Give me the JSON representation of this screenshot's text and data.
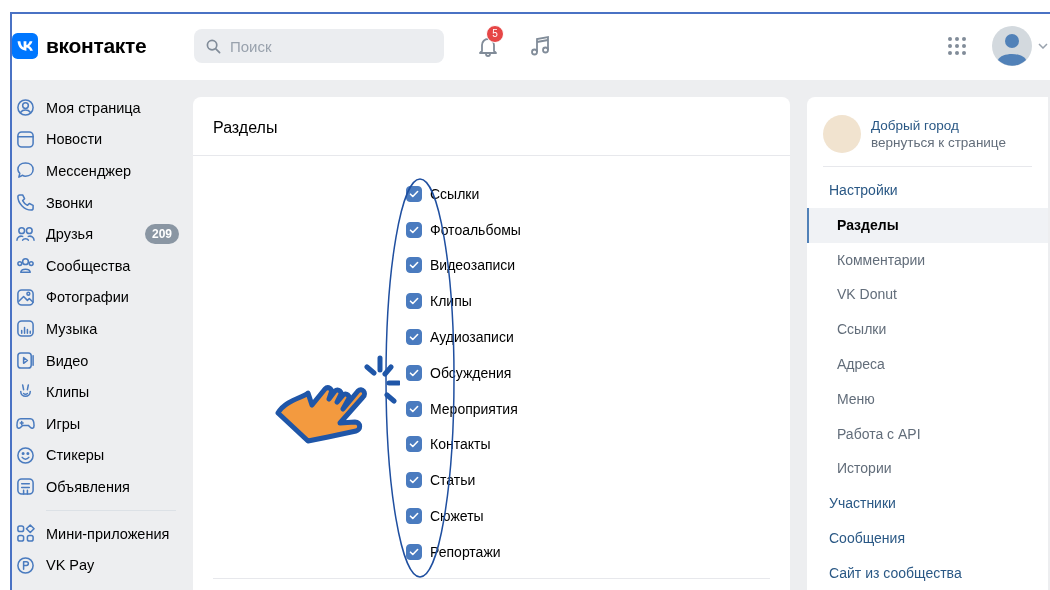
{
  "header": {
    "logo_text": "вконтакте",
    "search": {
      "placeholder": "Поиск"
    },
    "notifications_badge": "5"
  },
  "sidebar": {
    "items": [
      {
        "label": "Моя страница"
      },
      {
        "label": "Новости"
      },
      {
        "label": "Мессенджер"
      },
      {
        "label": "Звонки"
      },
      {
        "label": "Друзья",
        "badge": "209"
      },
      {
        "label": "Сообщества"
      },
      {
        "label": "Фотографии"
      },
      {
        "label": "Музыка"
      },
      {
        "label": "Видео"
      },
      {
        "label": "Клипы"
      },
      {
        "label": "Игры"
      },
      {
        "label": "Стикеры"
      },
      {
        "label": "Объявления"
      },
      {
        "label": "Мини-приложения",
        "separated": true
      },
      {
        "label": "VK Pay"
      }
    ]
  },
  "sections_panel": {
    "title": "Разделы",
    "options": [
      {
        "label": "Ссылки",
        "checked": true
      },
      {
        "label": "Фотоальбомы",
        "checked": true
      },
      {
        "label": "Видеозаписи",
        "checked": true
      },
      {
        "label": "Клипы",
        "checked": true
      },
      {
        "label": "Аудиозаписи",
        "checked": true
      },
      {
        "label": "Обсуждения",
        "checked": true
      },
      {
        "label": "Мероприятия",
        "checked": true
      },
      {
        "label": "Контакты",
        "checked": true
      },
      {
        "label": "Статьи",
        "checked": true
      },
      {
        "label": "Сюжеты",
        "checked": true
      },
      {
        "label": "Репортажи",
        "checked": true
      }
    ]
  },
  "settings_menu": {
    "group": {
      "name": "Добрый город",
      "link": "вернуться к странице"
    },
    "items": [
      {
        "label": "Настройки",
        "kind": "section",
        "selected": false
      },
      {
        "label": "Разделы",
        "kind": "sub",
        "selected": true
      },
      {
        "label": "Комментарии",
        "kind": "sub",
        "selected": false
      },
      {
        "label": "VK Donut",
        "kind": "sub",
        "selected": false
      },
      {
        "label": "Ссылки",
        "kind": "sub",
        "selected": false
      },
      {
        "label": "Адреса",
        "kind": "sub",
        "selected": false
      },
      {
        "label": "Меню",
        "kind": "sub",
        "selected": false
      },
      {
        "label": "Работа с API",
        "kind": "sub",
        "selected": false
      },
      {
        "label": "Истории",
        "kind": "sub",
        "selected": false
      },
      {
        "label": "Участники",
        "kind": "section",
        "selected": false
      },
      {
        "label": "Сообщения",
        "kind": "section",
        "selected": false
      },
      {
        "label": "Сайт из сообщества",
        "kind": "section",
        "selected": false
      }
    ]
  }
}
